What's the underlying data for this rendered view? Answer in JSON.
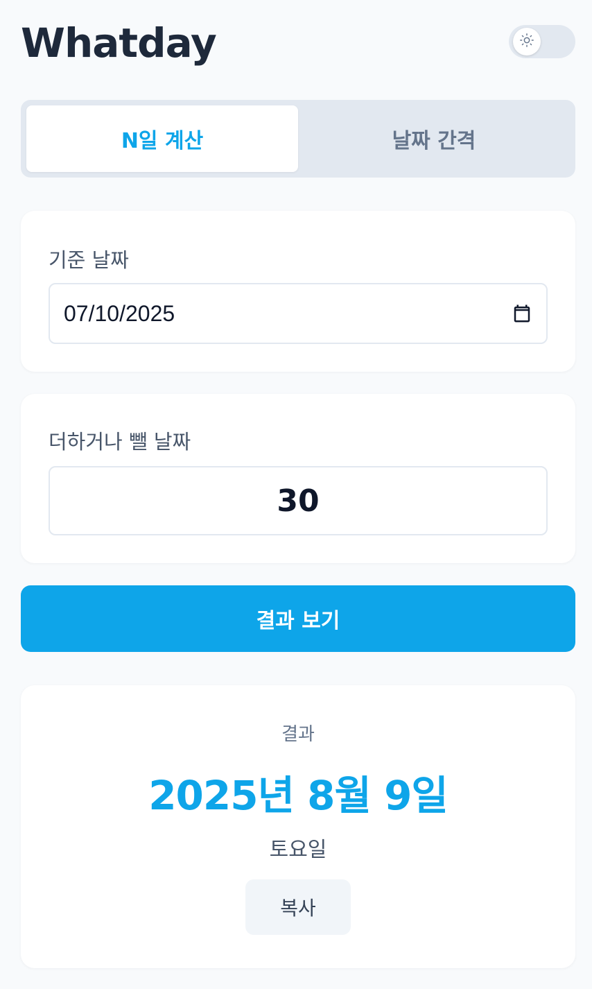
{
  "app": {
    "title": "Whatday"
  },
  "theme_toggle": {
    "icon": "sun-icon",
    "state": "light"
  },
  "tabs": [
    {
      "label": "N일 계산",
      "active": true
    },
    {
      "label": "날짜 간격",
      "active": false
    }
  ],
  "base_date": {
    "label": "기준 날짜",
    "value": "07/10/2025",
    "icon": "calendar-icon"
  },
  "days_offset": {
    "label": "더하거나 뺄 날짜",
    "value": "30"
  },
  "submit": {
    "label": "결과 보기"
  },
  "result": {
    "label": "결과",
    "date": "2025년 8월 9일",
    "weekday": "토요일",
    "copy_label": "복사"
  },
  "colors": {
    "accent": "#0ea5e9",
    "background": "#f8fafc",
    "title": "#1e293b"
  }
}
